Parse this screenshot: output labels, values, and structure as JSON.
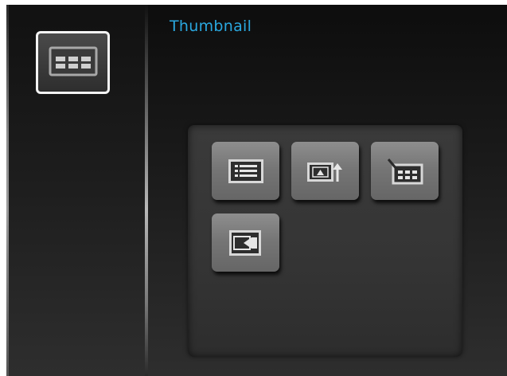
{
  "header": {
    "title": "Thumbnail"
  },
  "sidebar": {
    "current_mode": {
      "icon": "thumbnail-grid-icon"
    }
  },
  "options": [
    {
      "icon": "list-view-icon"
    },
    {
      "icon": "photo-export-icon"
    },
    {
      "icon": "edit-thumbnail-icon"
    },
    {
      "icon": "video-file-icon"
    }
  ],
  "colors": {
    "title": "#2aa8e0",
    "button_face": "#7a7a7a",
    "panel": "#353535",
    "background": "#1a1a1a"
  }
}
